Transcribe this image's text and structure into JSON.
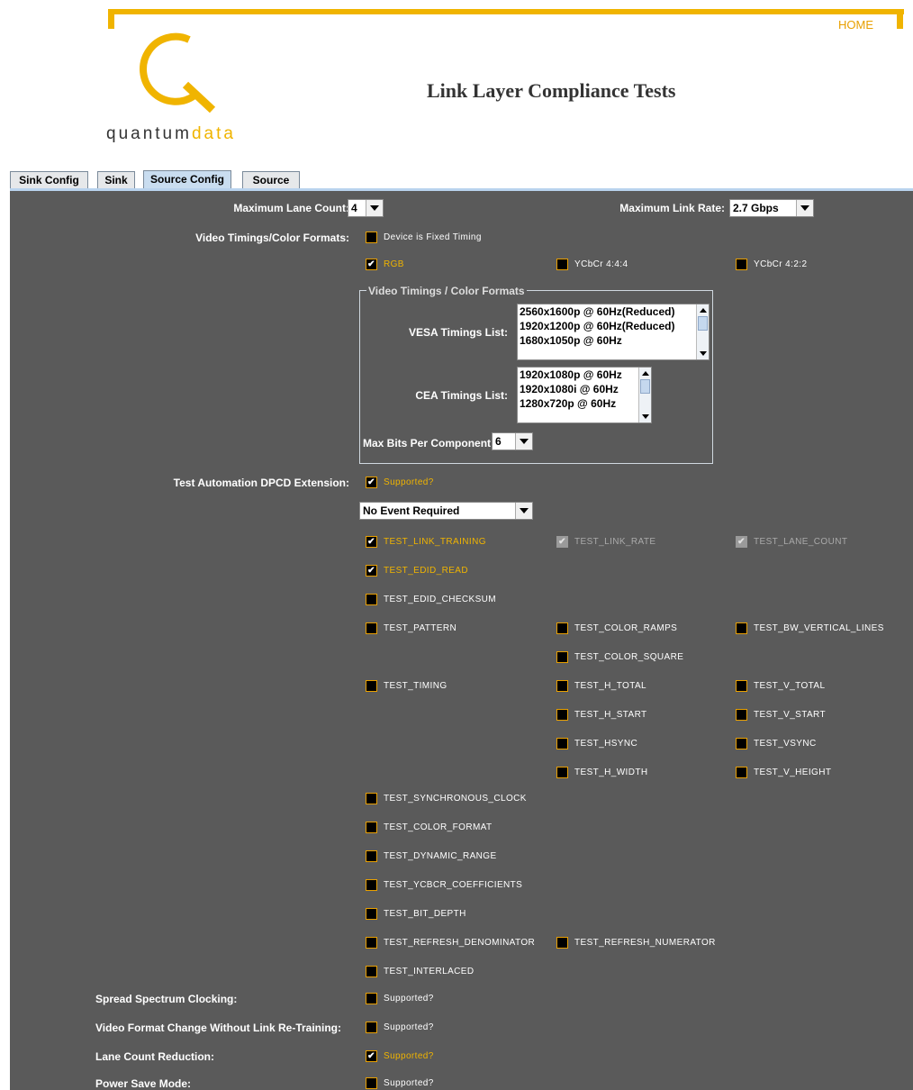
{
  "header": {
    "home_link": "HOME",
    "brand_left": "quantum",
    "brand_right": "data",
    "page_title": "Link Layer Compliance Tests",
    "accent": "#f0b400"
  },
  "tabs": [
    {
      "label": "Sink Config",
      "active": false
    },
    {
      "label": "Sink",
      "active": false
    },
    {
      "label": "Source Config",
      "active": true
    },
    {
      "label": "Source",
      "active": false
    }
  ],
  "config": {
    "max_lane_count_label": "Maximum Lane Count:",
    "max_lane_count_value": "4",
    "max_link_rate_label": "Maximum Link Rate:",
    "max_link_rate_value": "2.7 Gbps",
    "video_timings_label": "Video Timings/Color Formats:",
    "fixed_timing": "Device is Fixed Timing",
    "rgb": "RGB",
    "ycbcr444": "YCbCr 4:4:4",
    "ycbcr422": "YCbCr 4:2:2",
    "group_title": "Video Timings / Color Formats",
    "vesa_label": "VESA Timings List:",
    "vesa_items": [
      "2560x1600p @ 60Hz(Reduced)",
      "1920x1200p @ 60Hz(Reduced)",
      "1680x1050p @ 60Hz"
    ],
    "cea_label": "CEA Timings List:",
    "cea_items": [
      "1920x1080p @ 60Hz",
      "1920x1080i @ 60Hz",
      "1280x720p @ 60Hz"
    ],
    "max_bpc_label": "Max Bits Per Component:",
    "max_bpc_value": "6",
    "test_auto_label": "Test Automation DPCD Extension:",
    "supported": "Supported?",
    "event_value": "No Event Required",
    "tests": {
      "link_training": "TEST_LINK_TRAINING",
      "link_rate": "TEST_LINK_RATE",
      "lane_count": "TEST_LANE_COUNT",
      "edid_read": "TEST_EDID_READ",
      "edid_checksum": "TEST_EDID_CHECKSUM",
      "pattern": "TEST_PATTERN",
      "color_ramps": "TEST_COLOR_RAMPS",
      "bw_vertical_lines": "TEST_BW_VERTICAL_LINES",
      "color_square": "TEST_COLOR_SQUARE",
      "timing": "TEST_TIMING",
      "h_total": "TEST_H_TOTAL",
      "v_total": "TEST_V_TOTAL",
      "h_start": "TEST_H_START",
      "v_start": "TEST_V_START",
      "hsync": "TEST_HSYNC",
      "vsync": "TEST_VSYNC",
      "h_width": "TEST_H_WIDTH",
      "v_height": "TEST_V_HEIGHT",
      "synchronous_clock": "TEST_SYNCHRONOUS_CLOCK",
      "color_format": "TEST_COLOR_FORMAT",
      "dynamic_range": "TEST_DYNAMIC_RANGE",
      "ycbcr_coefficients": "TEST_YCBCR_COEFFICIENTS",
      "bit_depth": "TEST_BIT_DEPTH",
      "refresh_denominator": "TEST_REFRESH_DENOMINATOR",
      "refresh_numerator": "TEST_REFRESH_NUMERATOR",
      "interlaced": "TEST_INTERLACED"
    },
    "ssc_label": "Spread Spectrum Clocking:",
    "vfc_label": "Video Format Change Without Link Re-Training:",
    "lcr_label": "Lane Count Reduction:",
    "psm_label": "Power Save Mode:"
  }
}
